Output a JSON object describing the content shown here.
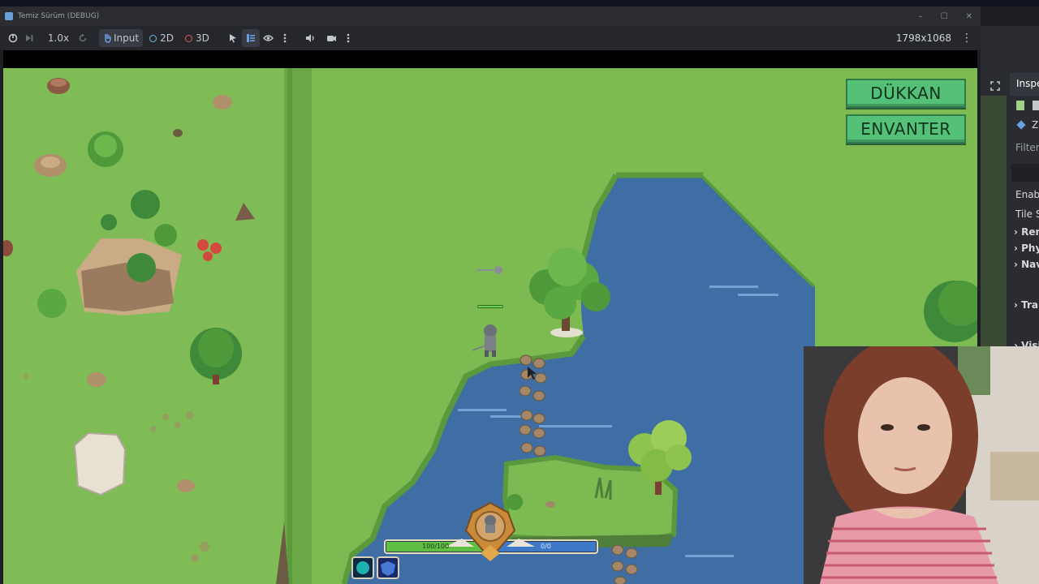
{
  "window": {
    "title": "Temiz Sürüm (DEBUG)",
    "controls": [
      "–",
      "☐",
      "✕"
    ]
  },
  "toolbar": {
    "speed": "1.0x",
    "input_label": "Input",
    "mode_2d": "2D",
    "mode_3d": "3D",
    "resolution": "1798x1068"
  },
  "game_ui": {
    "shop_button": "DÜKKAN",
    "inventory_button": "ENVANTER",
    "health_text": "100/100",
    "mana_text": "0/0"
  },
  "inspector": {
    "title": "Inspe",
    "node": "Zo",
    "filter": "Filter",
    "enabled": "Enabl",
    "tile_set": "Tile S",
    "sections": [
      "Ren",
      "Phy",
      "Nav",
      "Tran",
      "Visi"
    ]
  },
  "colors": {
    "grass": "#7dbb52",
    "water": "#3f6ea4",
    "button_green": "#55c077",
    "health_green": "#5fbf45",
    "mana_blue": "#3d79c7"
  }
}
